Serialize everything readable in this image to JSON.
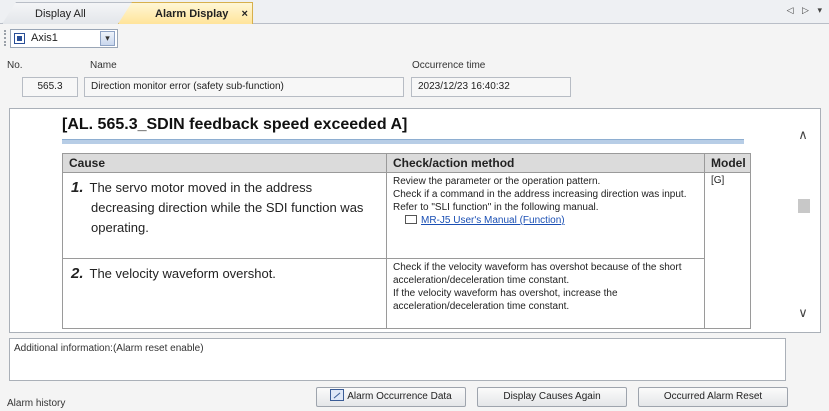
{
  "tabs": [
    {
      "label": "Display All"
    },
    {
      "label": "Alarm Display",
      "close": "×"
    }
  ],
  "tab_nav": "◁ ▷ ▾",
  "axis": {
    "selected": "Axis1",
    "dropdown_arrow": "▾"
  },
  "header": {
    "no_label": "No.",
    "name_label": "Name",
    "time_label": "Occurrence time",
    "no_value": "565.3",
    "name_value": "Direction monitor error (safety sub-function)",
    "time_value": "2023/12/23 16:40:32"
  },
  "detail": {
    "title": "[AL. 565.3_SDIN feedback speed exceeded A]",
    "columns": [
      "Cause",
      "Check/action method",
      "Model"
    ],
    "rows": [
      {
        "num": "1.",
        "cause": "The servo motor moved in the address decreasing direction while the SDI function was operating.",
        "check_lines": [
          "Review the parameter or the operation pattern.",
          "Check if a command in the address increasing direction was input.",
          "Refer to \"SLI function\" in the following manual."
        ],
        "link": "MR-J5 User's Manual (Function)",
        "model": "[G]"
      },
      {
        "num": "2.",
        "cause": "The velocity waveform overshot.",
        "check_lines": [
          "Check if the velocity waveform has overshot because of the short acceleration/deceleration time constant.",
          "If the velocity waveform has overshot, increase the acceleration/deceleration time constant."
        ],
        "model": ""
      }
    ]
  },
  "scroll": {
    "up": "∧",
    "down": "∨"
  },
  "additional_info": "Additional information:(Alarm reset enable)",
  "bottom": {
    "history_label": "Alarm history",
    "btn_occurrence": "Alarm Occurrence Data",
    "btn_causes": "Display Causes Again",
    "btn_reset": "Occurred Alarm Reset"
  },
  "colors": {
    "active_tab": "#ffe49a",
    "heading_rule": "#b7cde6",
    "link": "#1a4fb4"
  },
  "icons": [
    "axis-icon",
    "dropdown-arrow-icon",
    "manual-link-icon",
    "alarm-occurrence-icon",
    "scroll-up-icon",
    "scroll-down-icon"
  ]
}
